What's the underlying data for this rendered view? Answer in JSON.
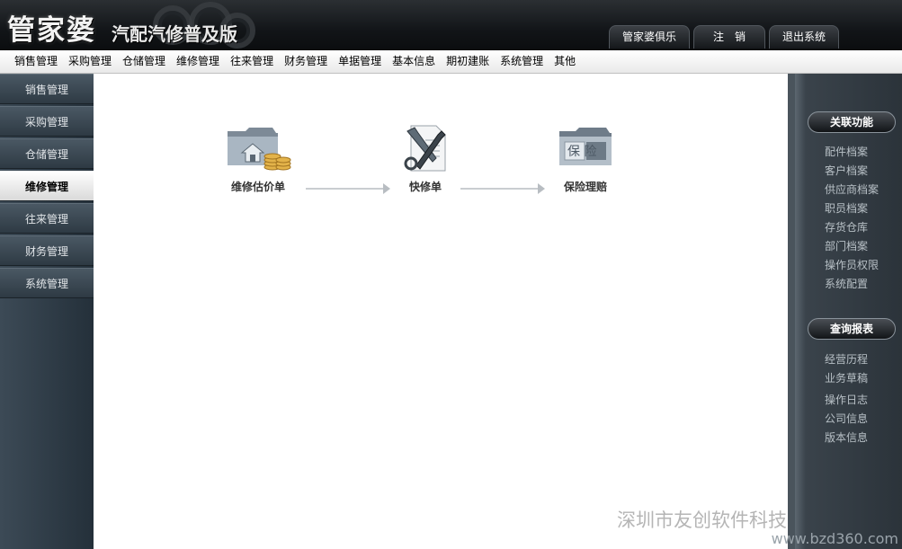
{
  "header": {
    "logo_main": "管家婆",
    "logo_sub": "汽配汽修普及版",
    "buttons": {
      "club": "管家婆俱乐部",
      "logout": "注　销",
      "exit": "退出系统"
    }
  },
  "menu": [
    "销售管理",
    "采购管理",
    "仓储管理",
    "维修管理",
    "往来管理",
    "财务管理",
    "单据管理",
    "基本信息",
    "期初建账",
    "系统管理",
    "其他"
  ],
  "sidebar": {
    "items": [
      "销售管理",
      "采购管理",
      "仓储管理",
      "维修管理",
      "往来管理",
      "财务管理",
      "系统管理"
    ],
    "active": "维修管理"
  },
  "flow": {
    "nodes": [
      {
        "label": "维修估价单",
        "icon": "folder-house-coins-icon"
      },
      {
        "label": "快修单",
        "icon": "tools-document-icon"
      },
      {
        "label": "保险理赔",
        "icon": "insurance-folder-icon"
      }
    ],
    "insurance_icon_text": "保 险"
  },
  "rightbar": {
    "related_title": "关联功能",
    "related_links": [
      "配件档案",
      "客户档案",
      "供应商档案",
      "职员档案",
      "存货仓库",
      "部门档案",
      "操作员权限",
      "系统配置"
    ],
    "report_title": "查询报表",
    "report_links": [
      "经营历程",
      "业务草稿",
      "操作日志",
      "公司信息",
      "版本信息"
    ]
  },
  "watermark": "深圳市友创软件科技有限公司",
  "footer_url": "www.bzd360.com"
}
